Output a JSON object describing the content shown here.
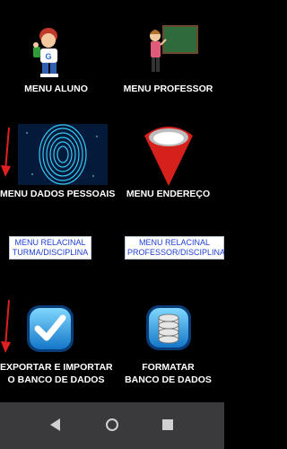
{
  "menu": {
    "aluno_label": "MENU ALUNO",
    "professor_label": "MENU PROFESSOR",
    "dados_pessoais_label": "MENU DADOS PESSOAIS",
    "endereco_label": "MENU ENDEREÇO",
    "rel_turma": {
      "line1": "MENU RELACINAL",
      "line2": "TURMA/DISCIPLINA"
    },
    "rel_prof": {
      "line1": "MENU RELACINAL",
      "line2": "PROFESSOR/DISCIPLINA"
    },
    "exportar": {
      "line1": "EXPORTAR E IMPORTAR",
      "line2": "O BANCO DE DADOS"
    },
    "formatar": {
      "line1": "FORMATAR",
      "line2": "BANCO DE DADOS"
    }
  },
  "icons": {
    "aluno": "student-icon",
    "professor": "teacher-at-board-icon",
    "dados": "fingerprint-icon",
    "endereco": "map-pin-icon",
    "exportar": "checkmark-icon",
    "formatar": "database-icon",
    "arrows": "red-arrow-icon"
  },
  "nav": {
    "back": "back-icon",
    "home": "home-icon",
    "recents": "recents-icon"
  },
  "colors": {
    "background": "#000000",
    "text": "#ffffff",
    "link": "#1e3fd0",
    "arrow": "#e02020",
    "navbar": "#3a3a3c"
  }
}
